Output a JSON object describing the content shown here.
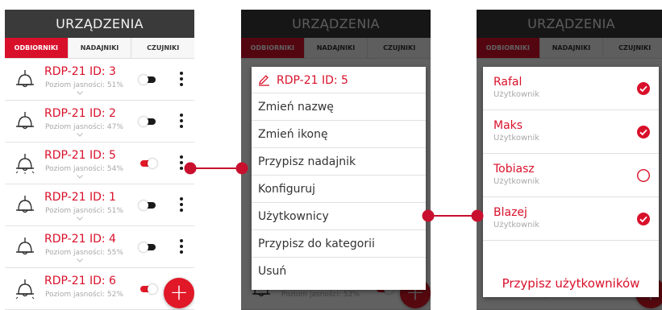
{
  "header": {
    "title": "URZĄDZENIA"
  },
  "tabs": [
    {
      "label": "ODBIORNIKI",
      "active": true
    },
    {
      "label": "NADAJNIKI",
      "active": false
    },
    {
      "label": "CZUJNIKI",
      "active": false
    }
  ],
  "devices": [
    {
      "title": "RDP-21 ID: 3",
      "subtitle": "Poziom jasności: 51%",
      "brightness_percent": 51,
      "on": false
    },
    {
      "title": "RDP-21 ID: 2",
      "subtitle": "Poziom jasności: 47%",
      "brightness_percent": 47,
      "on": false
    },
    {
      "title": "RDP-21 ID: 5",
      "subtitle": "Poziom jasności: 54%",
      "brightness_percent": 54,
      "on": true
    },
    {
      "title": "RDP-21 ID: 1",
      "subtitle": "Poziom jasności: 51%",
      "brightness_percent": 51,
      "on": false
    },
    {
      "title": "RDP-21 ID: 4",
      "subtitle": "Poziom jasności: 55%",
      "brightness_percent": 55,
      "on": false
    },
    {
      "title": "RDP-21 ID: 6",
      "subtitle": "Poziom jasności: 52%",
      "brightness_percent": 52,
      "on": true
    }
  ],
  "fab": {
    "label": "+"
  },
  "context_menu": {
    "title": "RDP-21 ID: 5",
    "items": [
      "Zmień nazwę",
      "Zmień ikonę",
      "Przypisz nadajnik",
      "Konfiguruj",
      "Użytkownicy",
      "Przypisz do kategorii",
      "Usuń"
    ]
  },
  "users_dialog": {
    "users": [
      {
        "name": "Rafal",
        "role": "Użytkownik",
        "checked": true
      },
      {
        "name": "Maks",
        "role": "Użytkownik",
        "checked": true
      },
      {
        "name": "Tobiasz",
        "role": "Użytkownik",
        "checked": false
      },
      {
        "name": "Blazej",
        "role": "Użytkownik",
        "checked": true
      }
    ],
    "action_label": "Przypisz użytkowników"
  },
  "colors": {
    "accent": "#d9102a",
    "topbar": "#3a3a3a",
    "toggle_off": "#1a1a1a",
    "connector": "#c8102e"
  }
}
